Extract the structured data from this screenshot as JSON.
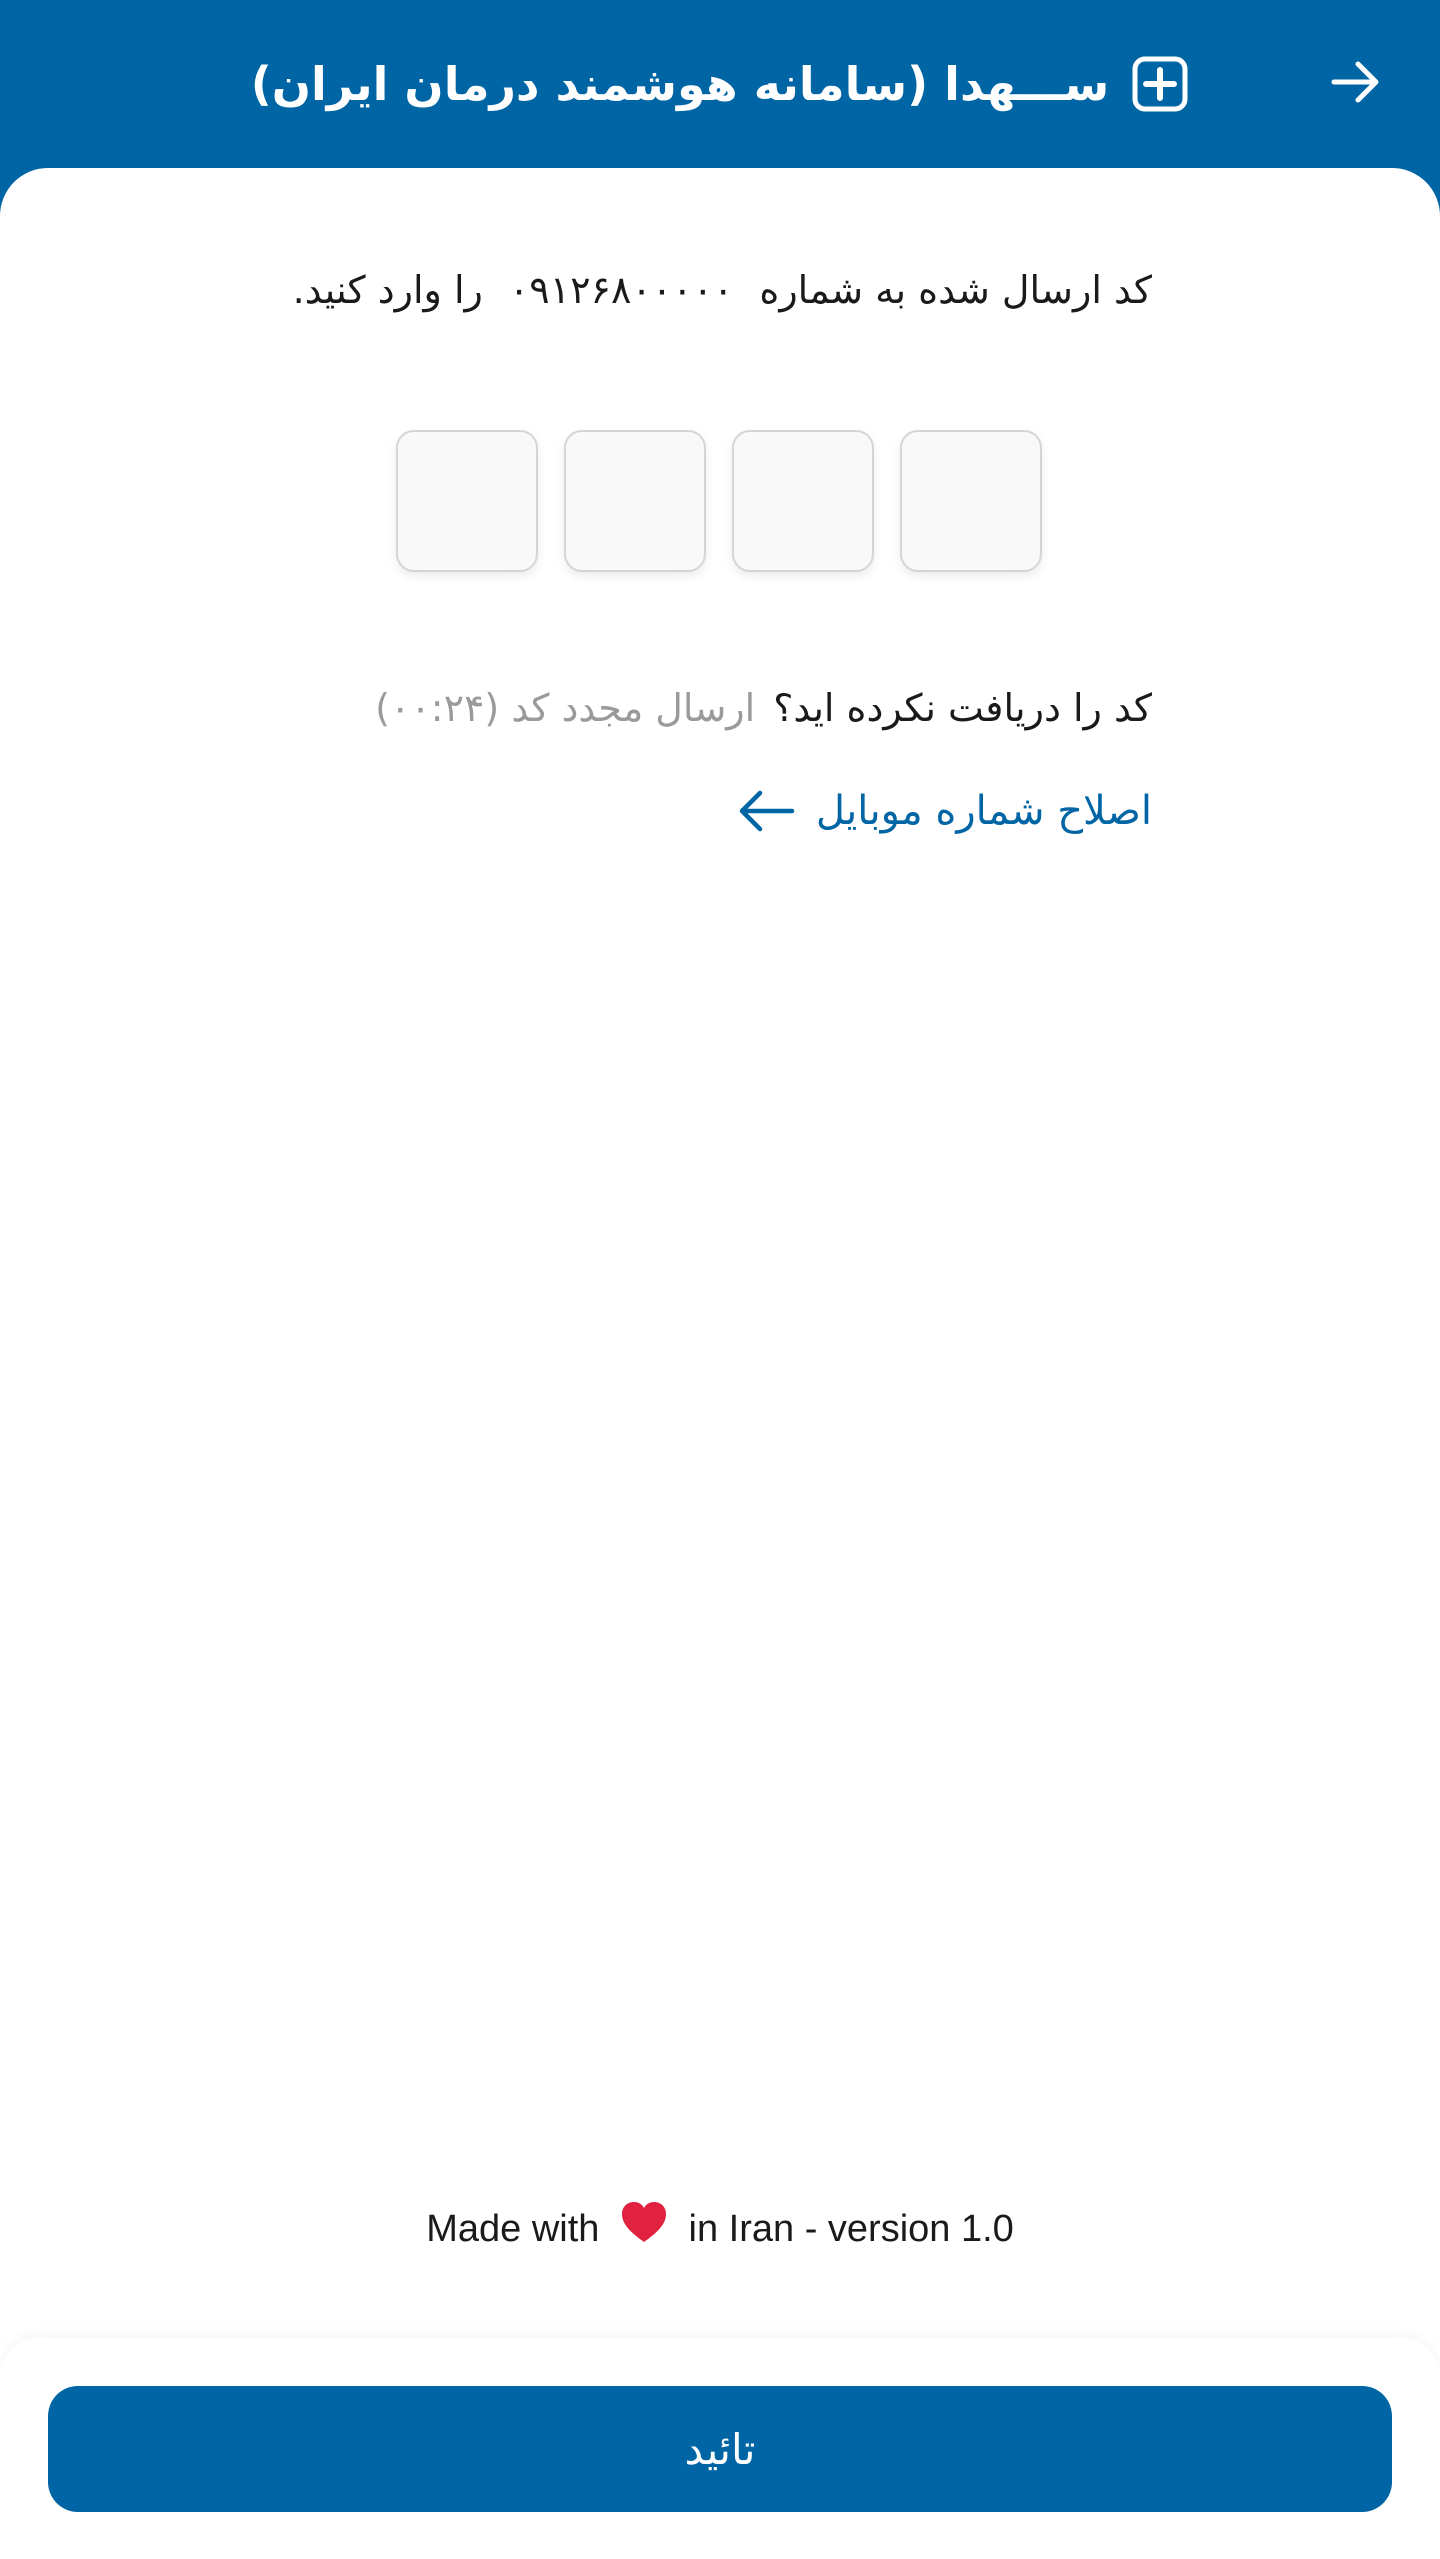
{
  "header": {
    "title": "ســـهدا (سامانه هوشمند درمان ایران)",
    "back_icon": "arrow-right-icon",
    "logo_icon": "plus-square-icon"
  },
  "verification": {
    "instruction_before": "کد ارسال شده به شماره",
    "phone": "۰۹۱۲۶۸۰۰۰۰۰",
    "instruction_after": "را وارد کنید.",
    "code_length": 4,
    "resend_question": "کد را دریافت نکرده اید؟",
    "resend_label": "ارسال مجدد کد (۰۰:۲۴)",
    "edit_phone_label": "اصلاح شماره موبایل",
    "edit_phone_icon": "arrow-left-icon"
  },
  "footer": {
    "made_with": "Made with",
    "heart_icon": "heart-icon",
    "in_iran": "in Iran - version 1.0"
  },
  "actions": {
    "confirm_label": "تائید"
  },
  "colors": {
    "primary": "#0065a4",
    "muted": "#9a9a9a",
    "heart": "#e0213f"
  }
}
